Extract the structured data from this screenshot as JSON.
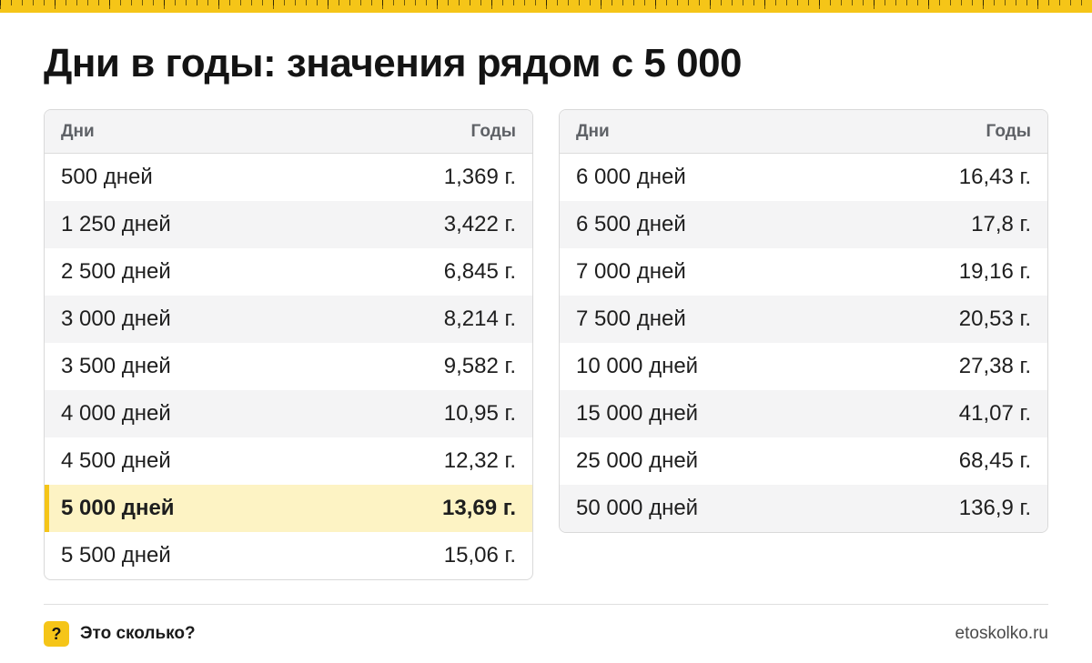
{
  "title": "Дни в годы: значения рядом с 5 000",
  "accent_color": "#f5c518",
  "highlight_color": "#fdf3c4",
  "tables": [
    {
      "headers": {
        "left": "Дни",
        "right": "Годы"
      },
      "rows": [
        {
          "days": "500 дней",
          "years": "1,369 г."
        },
        {
          "days": "1 250 дней",
          "years": "3,422 г."
        },
        {
          "days": "2 500 дней",
          "years": "6,845 г."
        },
        {
          "days": "3 000 дней",
          "years": "8,214 г."
        },
        {
          "days": "3 500 дней",
          "years": "9,582 г."
        },
        {
          "days": "4 000 дней",
          "years": "10,95 г."
        },
        {
          "days": "4 500 дней",
          "years": "12,32 г."
        },
        {
          "days": "5 000 дней",
          "years": "13,69 г.",
          "highlighted": true
        },
        {
          "days": "5 500 дней",
          "years": "15,06 г."
        }
      ]
    },
    {
      "headers": {
        "left": "Дни",
        "right": "Годы"
      },
      "rows": [
        {
          "days": "6 000 дней",
          "years": "16,43 г."
        },
        {
          "days": "6 500 дней",
          "years": "17,8 г."
        },
        {
          "days": "7 000 дней",
          "years": "19,16 г."
        },
        {
          "days": "7 500 дней",
          "years": "20,53 г."
        },
        {
          "days": "10 000 дней",
          "years": "27,38 г."
        },
        {
          "days": "15 000 дней",
          "years": "41,07 г."
        },
        {
          "days": "25 000 дней",
          "years": "68,45 г."
        },
        {
          "days": "50 000 дней",
          "years": "136,9 г."
        }
      ]
    }
  ],
  "footer": {
    "badge_icon": "question-mark-icon",
    "badge_glyph": "?",
    "brand": "Это сколько?",
    "site": "etoskolko.ru"
  }
}
